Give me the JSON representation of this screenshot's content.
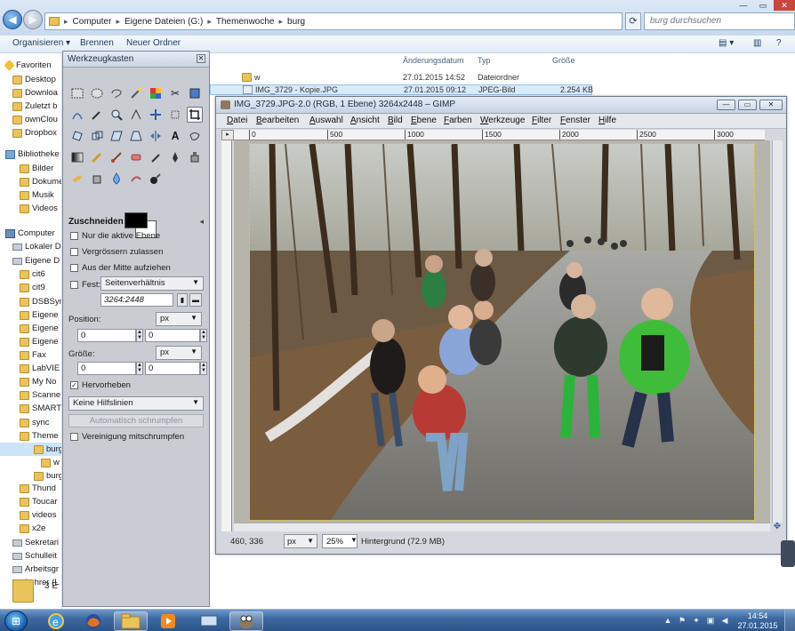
{
  "explorer": {
    "breadcrumb": [
      "Computer",
      "Eigene Dateien (G:)",
      "Themenwoche",
      "burg"
    ],
    "search_placeholder": "burg durchsuchen",
    "toolbar": {
      "organize": "Organisieren ▾",
      "burn": "Brennen",
      "new_folder": "Neuer Ordner"
    },
    "columns": {
      "date": "Änderungsdatum",
      "type": "Typ",
      "size": "Größe"
    },
    "files": [
      {
        "name": "w",
        "date": "27.01.2015 14:52",
        "type": "Dateiordner",
        "size": ""
      },
      {
        "name": "IMG_3729 - Kopie.JPG",
        "date": "27.01.2015 09:12",
        "type": "JPEG-Bild",
        "size": "2.254 KB"
      }
    ],
    "nav_items": [
      {
        "label": "Favoriten",
        "icon": "star-icon"
      },
      {
        "label": "Desktop",
        "icon": "desktop-icon"
      },
      {
        "label": "Downloa",
        "icon": "download-icon"
      },
      {
        "label": "Zuletzt b",
        "icon": "recent-icon"
      },
      {
        "label": "ownClou",
        "icon": "cloud-icon"
      },
      {
        "label": "Dropbox",
        "icon": "dropbox-icon"
      },
      {
        "label": "Bibliotheke",
        "icon": "library-icon"
      },
      {
        "label": "Bilder",
        "icon": "pictures-icon"
      },
      {
        "label": "Dokume",
        "icon": "documents-icon"
      },
      {
        "label": "Musik",
        "icon": "music-icon"
      },
      {
        "label": "Videos",
        "icon": "videos-icon"
      },
      {
        "label": "Computer",
        "icon": "computer-icon"
      },
      {
        "label": "Lokaler D",
        "icon": "drive-icon"
      },
      {
        "label": "Eigene D",
        "icon": "drive-icon"
      },
      {
        "label": "cit6",
        "icon": "folder-icon"
      },
      {
        "label": "cit9",
        "icon": "folder-icon"
      },
      {
        "label": "DSBSyn",
        "icon": "folder-icon"
      },
      {
        "label": "Eigene",
        "icon": "folder-icon"
      },
      {
        "label": "Eigene",
        "icon": "folder-icon"
      },
      {
        "label": "Eigene",
        "icon": "folder-icon"
      },
      {
        "label": "Fax",
        "icon": "folder-icon"
      },
      {
        "label": "LabVIE",
        "icon": "folder-icon"
      },
      {
        "label": "My No",
        "icon": "folder-icon"
      },
      {
        "label": "Scanne",
        "icon": "folder-icon"
      },
      {
        "label": "SMART",
        "icon": "folder-icon"
      },
      {
        "label": "sync",
        "icon": "folder-icon"
      },
      {
        "label": "Theme",
        "icon": "folder-icon"
      },
      {
        "label": "burg",
        "icon": "folder-icon"
      },
      {
        "label": "w",
        "icon": "folder-icon"
      },
      {
        "label": "burg",
        "icon": "folder-icon"
      },
      {
        "label": "Thund",
        "icon": "folder-icon"
      },
      {
        "label": "Toucar",
        "icon": "folder-icon"
      },
      {
        "label": "videos",
        "icon": "folder-icon"
      },
      {
        "label": "x2e",
        "icon": "folder-icon"
      },
      {
        "label": "Sekretari",
        "icon": "network-drive-icon"
      },
      {
        "label": "Schulleit",
        "icon": "network-drive-icon"
      },
      {
        "label": "Arbeitsgr",
        "icon": "network-drive-icon"
      },
      {
        "label": "Lehrer (L",
        "icon": "network-drive-icon"
      }
    ],
    "item_count": "3 E"
  },
  "toolbox": {
    "title": "Werkzeugkasten",
    "options_title": "Zuschneiden",
    "only_active_layer": "Nur die aktive Ebene",
    "allow_grow": "Vergrössern zulassen",
    "expand_center": "Aus der Mitte aufziehen",
    "fixed_label": "Fest:",
    "fixed_mode": "Seitenverhältnis",
    "ratio": "3264:2448",
    "position_label": "Position:",
    "position_unit": "px",
    "position_x": "0",
    "position_y": "0",
    "size_label": "Größe:",
    "size_unit": "px",
    "size_w": "0",
    "size_h": "0",
    "highlight": "Hervorheben",
    "guides": "Keine Hilfslinien",
    "auto_shrink": "Automatisch schrumpfen",
    "shrink_merged": "Vereinigung mitschrumpfen",
    "fg_color": "#000000",
    "bg_color": "#ffffff"
  },
  "image_window": {
    "title": "IMG_3729.JPG-2.0 (RGB, 1 Ebene) 3264x2448 – GIMP",
    "menus": [
      "Datei",
      "Bearbeiten",
      "Auswahl",
      "Ansicht",
      "Bild",
      "Ebene",
      "Farben",
      "Werkzeuge",
      "Filter",
      "Fenster",
      "Hilfe"
    ],
    "ruler_ticks": [
      "0",
      "500",
      "1000",
      "1500",
      "2000",
      "2500",
      "3000"
    ],
    "pointer_coords": "460, 336",
    "unit": "px",
    "zoom": "25%",
    "layer_info": "Hintergrund (72.9 MB)"
  },
  "taskbar": {
    "time": "14:54",
    "date": "27.01.2015"
  }
}
